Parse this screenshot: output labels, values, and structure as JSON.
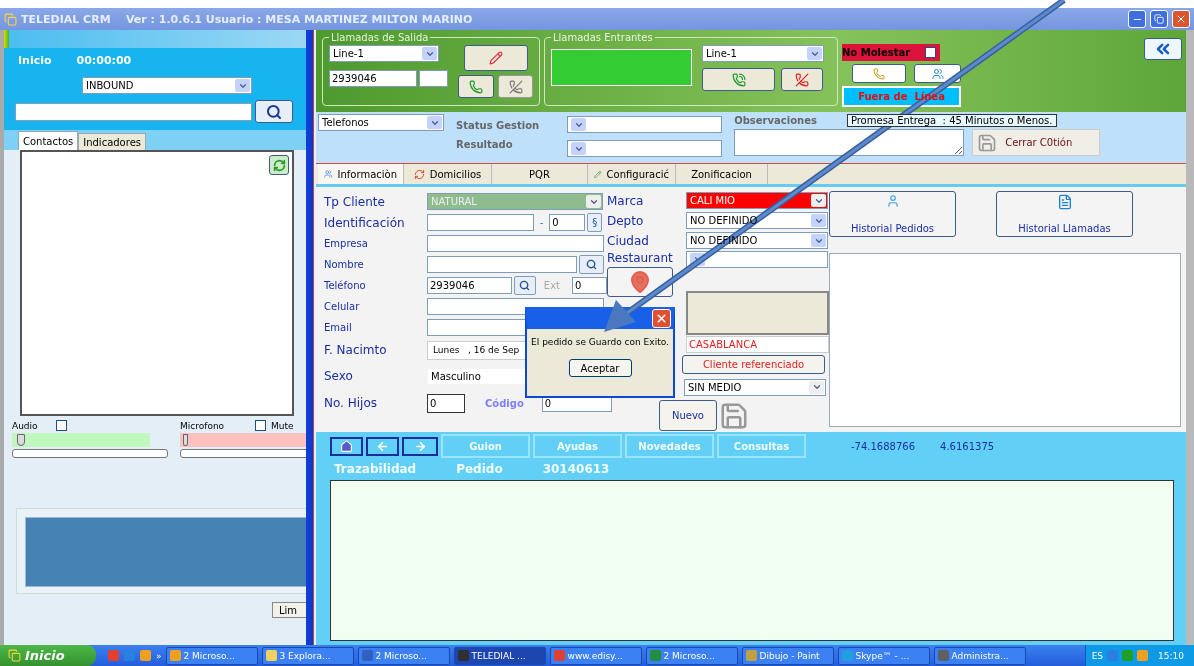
{
  "window": {
    "title": "TELEDIAL CRM    Ver : 1.0.6.1 Usuario : MESA MARTINEZ MILTON MARINO"
  },
  "left_panel": {
    "status": "Inicio",
    "timer": "00:00:00",
    "campaign": "INBOUND",
    "tabs": [
      {
        "label": "Contactos",
        "selected": true
      },
      {
        "label": "Indicadores",
        "selected": false
      }
    ],
    "audio": {
      "label": "Audio",
      "checked": false,
      "level": 0.04
    },
    "microphone": {
      "label": "Microfono",
      "mute_label": "Mute",
      "muted": false,
      "level": 0.02
    },
    "clear_button": "Lim"
  },
  "outgoing": {
    "legend": "Llamadas de Salida",
    "line": "Line-1",
    "number": "2939046"
  },
  "incoming": {
    "legend": "Llamadas Entrantes",
    "line": "Line-1"
  },
  "do_not_disturb": {
    "label": "No Molestar",
    "checked": false
  },
  "offline_button": "Fuera de  Línea",
  "management": {
    "phones": "Telefonos",
    "status_label": "Status Gestion",
    "result_label": "Resultado",
    "observations_label": "Observaciones",
    "promise": "Promesa Entrega  : 45 Minutos o Menos.",
    "close_button": "Cerrar C0tión"
  },
  "tabs": [
    {
      "label": "Informaciòn",
      "selected": true
    },
    {
      "label": "Domicilios",
      "selected": false
    },
    {
      "label": "PQR",
      "selected": false
    },
    {
      "label": "Configuracić",
      "selected": false
    },
    {
      "label": "Zonificacion",
      "selected": false
    }
  ],
  "client": {
    "type": {
      "label": "Tp Cliente",
      "value": "NATURAL"
    },
    "id": {
      "label": "Identificación",
      "separator": "-",
      "digit": "0",
      "button": "§"
    },
    "company": {
      "label": "Empresa"
    },
    "name": {
      "label": "Nombre"
    },
    "phone": {
      "label": "Teléfono",
      "value": "2939046",
      "ext_label": "Ext",
      "ext": "0"
    },
    "mobile": {
      "label": "Celular"
    },
    "email": {
      "label": "Email"
    },
    "birth": {
      "label": "F. Nacimto",
      "value": "Lunes   , 16 de Sep"
    },
    "sex": {
      "label": "Sexo",
      "value": "Masculino"
    },
    "children": {
      "label": "No. Hijos",
      "value": "0"
    },
    "code": {
      "label": "Código",
      "value": "0"
    }
  },
  "location": {
    "brand": {
      "label": "Marca",
      "value": "CALI MIO"
    },
    "state": {
      "label": "Depto",
      "value": "NO DEFINIDO"
    },
    "city": {
      "label": "Ciudad",
      "value": "NO DEFINIDO"
    },
    "restaurant": {
      "label": "Restaurant"
    },
    "zone": "CASABLANCA",
    "referred_button": "Cliente referenciado",
    "medium": "SIN MEDIO",
    "new_button": "Nuevo"
  },
  "history_buttons": [
    "Historial Pedidos",
    "Historial Llamadas"
  ],
  "bottom": {
    "buttons": [
      "Guion",
      "Ayudas",
      "Novedades",
      "Consultas"
    ],
    "longitude": "-74.1688766",
    "latitude": "4.6161375",
    "trace_label": "Trazabilidad",
    "order_label": "Pedido",
    "order_number": "30140613"
  },
  "dialog": {
    "message": "El pedido se Guardo con Exito.",
    "button": "Aceptar"
  },
  "taskbar": {
    "start": "Inicio",
    "more": "»",
    "tasks": [
      {
        "label": "2 Microso...",
        "selected": false,
        "color": "#f0a020"
      },
      {
        "label": "3 Explora...",
        "selected": false,
        "color": "#f0d060"
      },
      {
        "label": "2 Microso...",
        "selected": false,
        "color": "#3060c0"
      },
      {
        "label": "TELEDIAL ...",
        "selected": true,
        "color": "#303030"
      },
      {
        "label": "www.edisy...",
        "selected": false,
        "color": "#e04030"
      },
      {
        "label": "2 Microso...",
        "selected": false,
        "color": "#209040"
      },
      {
        "label": "Dibujo - Paint",
        "selected": false,
        "color": "#c0a040"
      },
      {
        "label": "Skype™ - ...",
        "selected": false,
        "color": "#20a0e0"
      },
      {
        "label": "Administra...",
        "selected": false,
        "color": "#606060"
      }
    ],
    "language": "ES",
    "clock": "15:10"
  }
}
